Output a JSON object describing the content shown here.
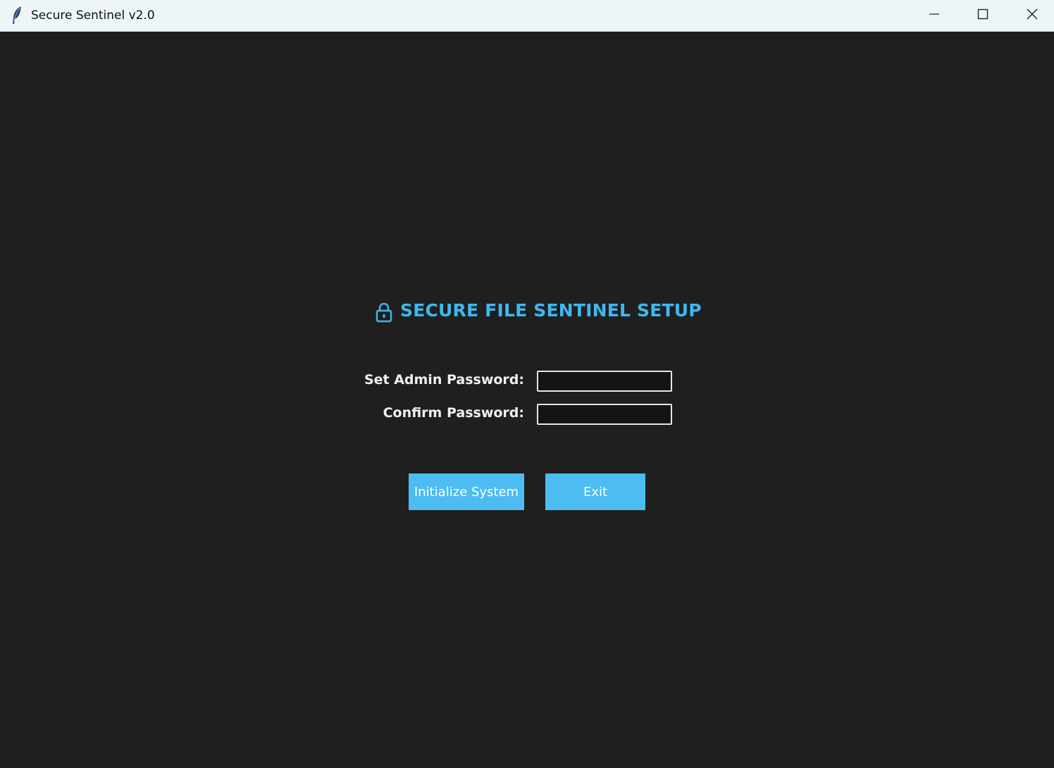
{
  "window": {
    "title": "Secure Sentinel v2.0",
    "app_icon": "feather-icon",
    "controls": {
      "minimize": "minimize-icon",
      "maximize": "maximize-icon",
      "close": "close-icon"
    }
  },
  "setup": {
    "heading_icon": "lock-icon",
    "heading": "SECURE FILE SENTINEL SETUP",
    "admin_password_label": "Set Admin Password:",
    "admin_password_value": "",
    "confirm_password_label": "Confirm Password:",
    "confirm_password_value": "",
    "initialize_button": "Initialize System",
    "exit_button": "Exit"
  },
  "colors": {
    "background": "#1f1f1f",
    "accent": "#3fb8ee",
    "button": "#4cbcf2",
    "titlebar": "#eef5f9"
  }
}
